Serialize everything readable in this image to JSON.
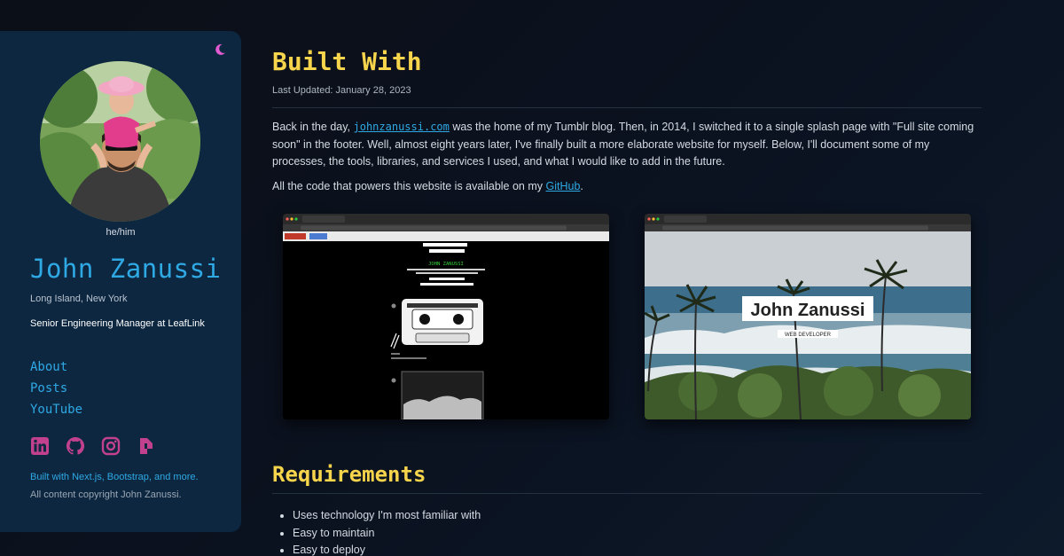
{
  "profile": {
    "pronouns": "he/him",
    "name": "John Zanussi",
    "location": "Long Island, New York",
    "job": "Senior Engineering Manager at LeafLink"
  },
  "nav": {
    "items": [
      {
        "label": "About"
      },
      {
        "label": "Posts"
      },
      {
        "label": "YouTube"
      }
    ]
  },
  "socials": [
    "linkedin-icon",
    "github-icon",
    "instagram-icon",
    "polywork-icon"
  ],
  "footer": {
    "built_with": "Built with Next.js, Bootstrap, and more.",
    "copyright": "All content copyright John Zanussi."
  },
  "page": {
    "title": "Built With",
    "updated": "Last Updated: January 28, 2023",
    "para1": {
      "before": "Back in the day, ",
      "link": "johnzanussi.com",
      "after": " was the home of my Tumblr blog. Then, in 2014, I switched it to a single splash page with \"Full site coming soon\" in the footer. Well, almost eight years later, I've finally built a more elaborate website for myself. Below, I'll document some of my processes, the tools, libraries, and services I used, and what I would like to add in the future."
    },
    "para2": {
      "before": "All the code that powers this website is available on my ",
      "link": "GitHub",
      "after": "."
    },
    "screenshots": {
      "left_heading": "JOHN ZANUSSI",
      "right_name": "John Zanussi",
      "right_subtitle": "WEB DEVELOPER"
    },
    "requirements": {
      "title": "Requirements",
      "items": [
        "Uses technology I'm most familiar with",
        "Easy to maintain",
        "Easy to deploy"
      ]
    }
  },
  "colors": {
    "accent_blue": "#2fa9e4",
    "heading_yellow": "#f6d44c",
    "sidebar_bg": "#0d2741",
    "social_pink": "#c2418f"
  }
}
